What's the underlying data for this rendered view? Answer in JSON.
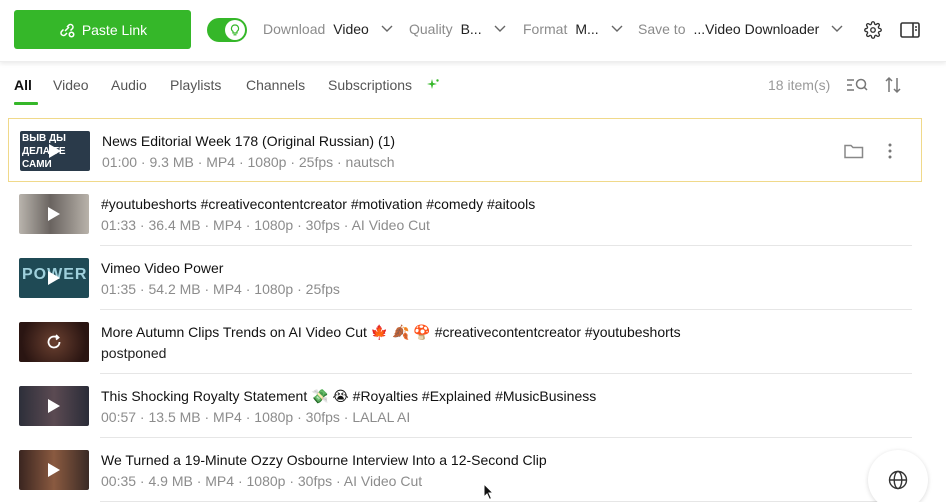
{
  "toolbar": {
    "paste_label": "Paste Link",
    "download_label": "Download",
    "download_value": "Video",
    "quality_label": "Quality",
    "quality_value": "B...",
    "format_label": "Format",
    "format_value": "M...",
    "saveto_label": "Save to",
    "saveto_value": "...Video Downloader",
    "smart_mode_on": true
  },
  "tabs": [
    "All",
    "Video",
    "Audio",
    "Playlists",
    "Channels",
    "Subscriptions"
  ],
  "active_tab": "All",
  "item_count": "18 item(s)",
  "items": [
    {
      "title": "News Editorial Week 178 (Original Russian) (1)",
      "meta": "01:00 · 9.3 MB · MP4 · 1080p · 25fps · nautsch",
      "thumb_text": "ВЫВ ДЫ ДЕЛА ТЕ САМИ",
      "thumb_color": "#2a3a4a",
      "state": "done"
    },
    {
      "title": "#youtubeshorts #creativecontentcreator #motivation #comedy #aitools",
      "meta": "01:33 · 36.4 MB · MP4 · 1080p · 30fps · AI Video Cut",
      "thumb_text": "",
      "thumb_color": "#8a8a90",
      "state": "done"
    },
    {
      "title": "Vimeo   Video Power",
      "meta": "01:35 · 54.2 MB · MP4 · 1080p · 25fps",
      "thumb_text": "POWER",
      "thumb_color": "#1f4a55",
      "state": "done"
    },
    {
      "title": "More Autumn Clips Trends on AI Video Cut 🍁 🍂 🍄 #creativecontentcreator #youtubeshorts",
      "meta": "postponed",
      "thumb_text": "",
      "thumb_color": "#3a2520",
      "state": "postponed"
    },
    {
      "title": "This Shocking Royalty Statement 💸 😭 #Royalties #Explained #MusicBusiness",
      "meta": "00:57 · 13.5 MB · MP4 · 1080p · 30fps · LALAL AI",
      "thumb_text": "",
      "thumb_color": "#3a3a48",
      "state": "done"
    },
    {
      "title": "We Turned a 19-Minute Ozzy Osbourne Interview Into a 12-Second Clip",
      "meta": "00:35 · 4.9 MB · MP4 · 1080p · 30fps · AI Video Cut",
      "thumb_text": "",
      "thumb_color": "#4a3025",
      "state": "done"
    }
  ],
  "colors": {
    "accent": "#35b729",
    "selected_border": "#f0d98a"
  }
}
